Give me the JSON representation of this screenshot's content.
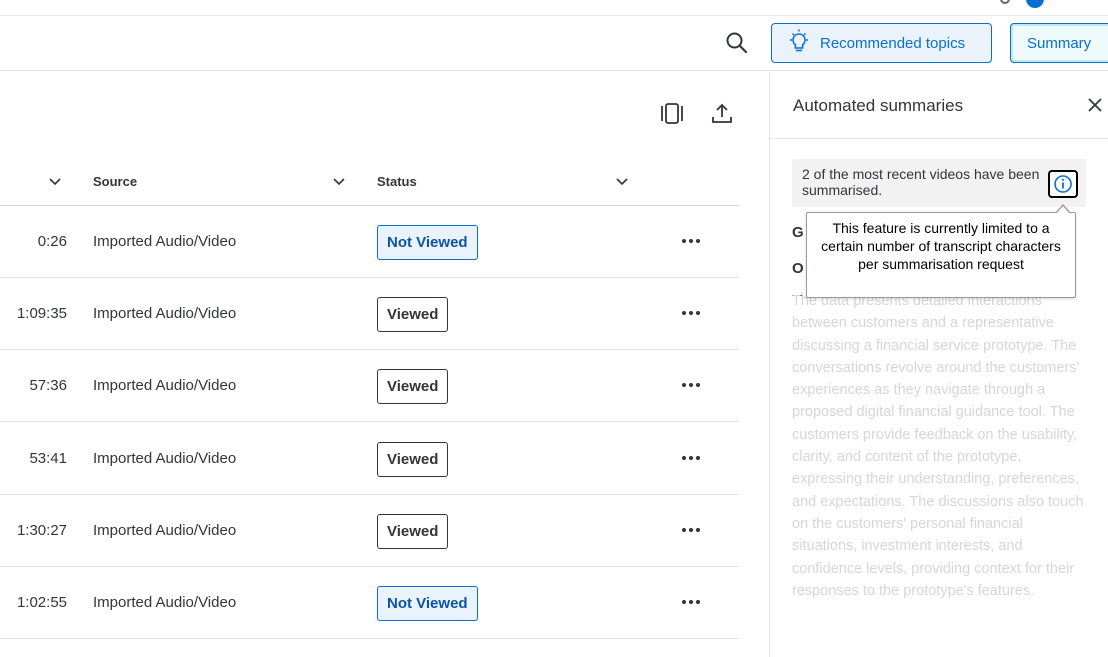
{
  "toolbar": {
    "recommended_label": "Recommended topics",
    "summary_label": "Summary"
  },
  "table": {
    "columns": [
      "Source",
      "Status"
    ],
    "rows": [
      {
        "duration": "0:26",
        "source": "Imported Audio/Video",
        "status": "Not Viewed"
      },
      {
        "duration": "1:09:35",
        "source": "Imported Audio/Video",
        "status": "Viewed"
      },
      {
        "duration": "57:36",
        "source": "Imported Audio/Video",
        "status": "Viewed"
      },
      {
        "duration": "53:41",
        "source": "Imported Audio/Video",
        "status": "Viewed"
      },
      {
        "duration": "1:30:27",
        "source": "Imported Audio/Video",
        "status": "Viewed"
      },
      {
        "duration": "1:02:55",
        "source": "Imported Audio/Video",
        "status": "Not Viewed"
      }
    ]
  },
  "panel": {
    "title": "Automated summaries",
    "info_text": "2 of the most recent videos have been summarised.",
    "tooltip": "This feature is currently limited to a certain number of transcript characters per summarisation request",
    "peek_heading_1": "G",
    "peek_heading_2": "O",
    "faded_summary": "The data presents detailed interactions between customers and a representative discussing a financial service prototype. The conversations revolve around the customers' experiences as they navigate through a proposed digital financial guidance tool. The customers provide feedback on the usability, clarity, and content of the prototype, expressing their understanding, preferences, and expectations. The discussions also touch on the customers' personal financial situations, investment interests, and confidence levels, providing context for their responses to the prototype's features."
  },
  "colors": {
    "accent": "#0a6ed1",
    "text": "#32363a",
    "border": "#e5e5e5"
  },
  "icons": {
    "search": "search-icon",
    "lightbulb": "lightbulb-icon",
    "columns": "column-settings-icon",
    "export": "export-icon",
    "chevron": "chevron-down-icon",
    "more": "more-icon",
    "close": "close-icon",
    "info": "info-icon"
  }
}
